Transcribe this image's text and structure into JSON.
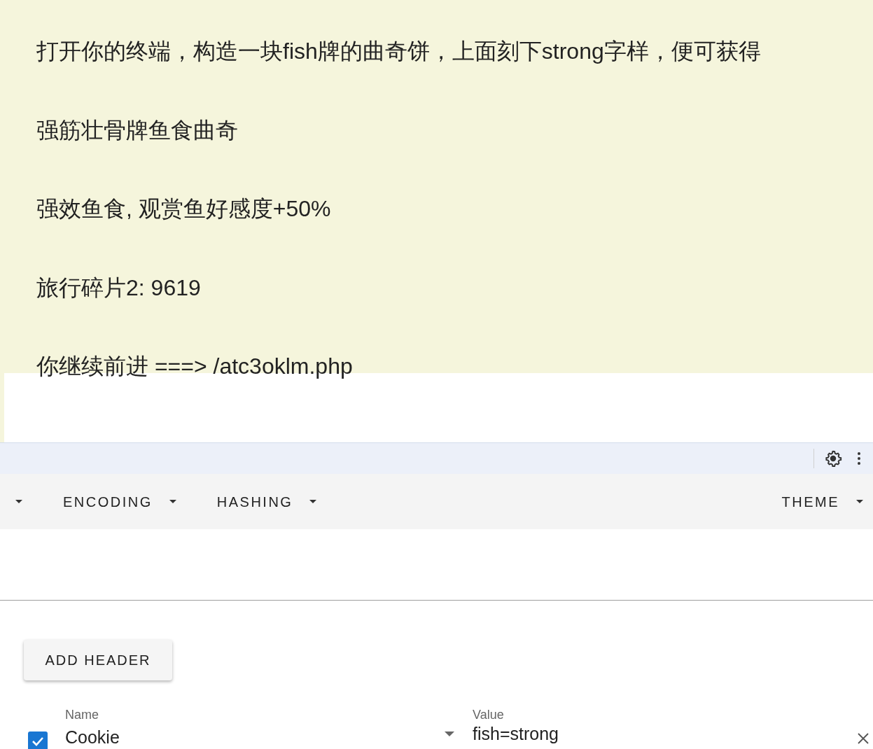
{
  "content": {
    "lines": [
      "打开你的终端，构造一块fish牌的曲奇饼，上面刻下strong字样，便可获得",
      "强筋壮骨牌鱼食曲奇",
      "强效鱼食, 观赏鱼好感度+50%",
      "旅行碎片2: 9619",
      "你继续前进 ===> /atc3oklm.php"
    ]
  },
  "toolbar": {
    "menus": [
      {
        "label": "ENCODING"
      },
      {
        "label": "HASHING"
      },
      {
        "label": "THEME"
      }
    ]
  },
  "add_header_button": "ADD HEADER",
  "headers": [
    {
      "checked": true,
      "name_label": "Name",
      "name": "Cookie",
      "value_label": "Value",
      "value": "fish=strong"
    }
  ]
}
